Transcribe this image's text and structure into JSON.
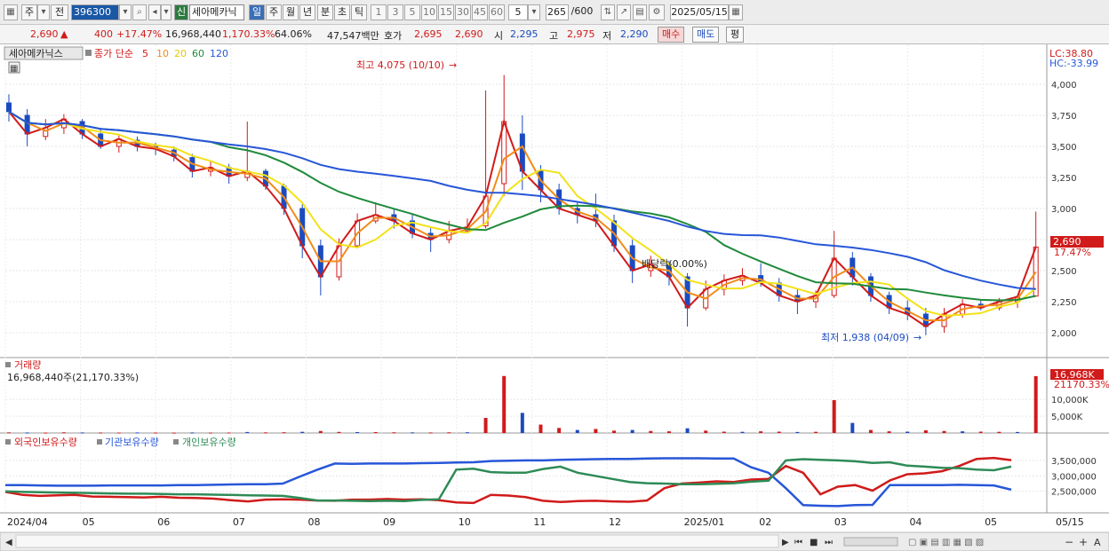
{
  "toolbar": {
    "type_label": "주",
    "prev_label": "전",
    "code": "396300",
    "stock_name": "세아메카닉",
    "new_badge": "신",
    "periods": [
      "일",
      "주",
      "월",
      "년",
      "분",
      "초",
      "틱"
    ],
    "active_period": "일",
    "intervals": [
      "1",
      "3",
      "5",
      "10",
      "15",
      "30",
      "45",
      "60"
    ],
    "interval_value": "5",
    "count_value": "265",
    "count_total": "/600",
    "date": "2025/05/15"
  },
  "quote": {
    "price": "2,690",
    "change": "400",
    "change_pct": "+17.47%",
    "volume": "16,968,440",
    "vol_ratio": "1,170.33%",
    "turnover": "64.06%",
    "amount": "47,547백만",
    "ask_label": "호가",
    "ask1": "2,695",
    "ask2": "2,690",
    "open_label": "시",
    "open": "2,295",
    "high_label": "고",
    "high": "2,975",
    "low_label": "저",
    "low": "2,290",
    "buy": "매수",
    "sell": "매도",
    "eval": "평"
  },
  "colors": {
    "up": "#d11a1a",
    "down": "#1b4bbf",
    "ma5": "#d11a1a",
    "ma10": "#f08c1a",
    "ma20": "#f2e21a",
    "ma60": "#1f8a3b",
    "ma120": "#2756d8",
    "foreign": "#d11a1a",
    "inst": "#2756d8",
    "retail": "#2e8b57"
  },
  "chart_data": [
    {
      "type": "candlestick",
      "panel": "price",
      "name_label": "세아메카닉스",
      "legend_label": "종가 단순",
      "ma_labels": [
        "5",
        "10",
        "20",
        "60",
        "120"
      ],
      "ylim": [
        1800,
        4150
      ],
      "yticks": [
        "4,000",
        "3,750",
        "3,500",
        "3,250",
        "3,000",
        "2,750",
        "2,500",
        "2,250",
        "2,000"
      ],
      "ytick_values": [
        4000,
        3750,
        3500,
        3250,
        3000,
        2750,
        2500,
        2250,
        2000
      ],
      "lc_label": "LC:38.80",
      "hc_label": "HC:-33.99",
      "current_price_label": "2,690",
      "current_pct_label": "17.47%",
      "annotations": {
        "high": "최고 4,075 (10/10)",
        "low": "최저 1,938 (04/09)",
        "dividend": "배당락(0.00%)"
      },
      "candles": [
        [
          3850,
          3780,
          3920,
          3700
        ],
        [
          3750,
          3600,
          3800,
          3500
        ],
        [
          3580,
          3650,
          3720,
          3550
        ],
        [
          3650,
          3720,
          3760,
          3600
        ],
        [
          3700,
          3600,
          3720,
          3560
        ],
        [
          3600,
          3500,
          3650,
          3480
        ],
        [
          3500,
          3560,
          3600,
          3450
        ],
        [
          3550,
          3500,
          3580,
          3460
        ],
        [
          3500,
          3480,
          3530,
          3430
        ],
        [
          3470,
          3420,
          3500,
          3380
        ],
        [
          3410,
          3300,
          3440,
          3250
        ],
        [
          3300,
          3330,
          3380,
          3260
        ],
        [
          3330,
          3260,
          3360,
          3200
        ],
        [
          3250,
          3300,
          3700,
          3220
        ],
        [
          3300,
          3180,
          3320,
          3150
        ],
        [
          3180,
          3000,
          3200,
          2950
        ],
        [
          3000,
          2700,
          3050,
          2600
        ],
        [
          2700,
          2450,
          2750,
          2300
        ],
        [
          2450,
          2700,
          2760,
          2420
        ],
        [
          2700,
          2900,
          2960,
          2680
        ],
        [
          2900,
          2950,
          3050,
          2880
        ],
        [
          2950,
          2900,
          3000,
          2840
        ],
        [
          2900,
          2800,
          2950,
          2760
        ],
        [
          2800,
          2750,
          2850,
          2650
        ],
        [
          2750,
          2820,
          2900,
          2720
        ],
        [
          2820,
          2850,
          2920,
          2800
        ],
        [
          2860,
          3100,
          3950,
          2840
        ],
        [
          3200,
          3700,
          4075,
          3100
        ],
        [
          3600,
          3300,
          3750,
          3150
        ],
        [
          3300,
          3150,
          3350,
          3050
        ],
        [
          3150,
          3000,
          3200,
          2950
        ],
        [
          3000,
          2950,
          3050,
          2880
        ],
        [
          2950,
          2900,
          3120,
          2850
        ],
        [
          2900,
          2700,
          2950,
          2650
        ],
        [
          2700,
          2500,
          2750,
          2400
        ],
        [
          2500,
          2550,
          2620,
          2450
        ],
        [
          2550,
          2450,
          2580,
          2380
        ],
        [
          2450,
          2200,
          2480,
          2050
        ],
        [
          2200,
          2350,
          2420,
          2180
        ],
        [
          2350,
          2420,
          2470,
          2300
        ],
        [
          2420,
          2460,
          2520,
          2380
        ],
        [
          2460,
          2400,
          2560,
          2370
        ],
        [
          2400,
          2300,
          2440,
          2250
        ],
        [
          2300,
          2250,
          2350,
          2150
        ],
        [
          2250,
          2300,
          2340,
          2200
        ],
        [
          2300,
          2600,
          2820,
          2280
        ],
        [
          2600,
          2450,
          2650,
          2380
        ],
        [
          2450,
          2300,
          2480,
          2250
        ],
        [
          2300,
          2200,
          2330,
          2150
        ],
        [
          2200,
          2150,
          2260,
          2100
        ],
        [
          2150,
          2050,
          2200,
          1980
        ],
        [
          2050,
          2150,
          2200,
          2000
        ],
        [
          2150,
          2230,
          2270,
          2120
        ],
        [
          2230,
          2200,
          2260,
          2180
        ],
        [
          2200,
          2250,
          2280,
          2180
        ],
        [
          2250,
          2290,
          2300,
          2200
        ],
        [
          2295,
          2690,
          2975,
          2290
        ]
      ]
    },
    {
      "type": "bar",
      "panel": "volume",
      "title": "거래량",
      "value_label": "16,968,440주(21,170.33%)",
      "ylim": [
        0,
        18000
      ],
      "yticks": [
        "10,000K",
        "5,000K"
      ],
      "ytick_values": [
        10000,
        5000
      ],
      "current_label": "16,968K",
      "current_pct": "21170.33%",
      "values": [
        180,
        150,
        120,
        200,
        160,
        140,
        130,
        150,
        120,
        110,
        160,
        120,
        140,
        300,
        180,
        220,
        350,
        600,
        320,
        280,
        260,
        200,
        180,
        160,
        200,
        220,
        4500,
        17000,
        6000,
        2500,
        1500,
        900,
        1200,
        700,
        900,
        600,
        500,
        1400,
        700,
        400,
        350,
        500,
        400,
        300,
        350,
        9800,
        3000,
        900,
        500,
        400,
        800,
        600,
        500,
        400,
        350,
        300,
        16968
      ]
    },
    {
      "type": "line",
      "panel": "holdings",
      "legend": [
        "외국인보유수량",
        "기관보유수량",
        "개인보유수량"
      ],
      "ylim": [
        1800000,
        3900000
      ],
      "yticks": [
        "3,500,000",
        "3,000,000",
        "2,500,000"
      ],
      "ytick_values": [
        3500000,
        3000000,
        2500000
      ],
      "series": [
        {
          "name": "외국인보유수량",
          "values": [
            2480000,
            2380000,
            2350000,
            2370000,
            2380000,
            2330000,
            2320000,
            2310000,
            2300000,
            2320000,
            2290000,
            2280000,
            2260000,
            2210000,
            2170000,
            2230000,
            2240000,
            2230000,
            2200000,
            2190000,
            2230000,
            2230000,
            2250000,
            2230000,
            2240000,
            2210000,
            2140000,
            2120000,
            2380000,
            2360000,
            2310000,
            2190000,
            2150000,
            2180000,
            2190000,
            2170000,
            2160000,
            2200000,
            2600000,
            2750000,
            2780000,
            2820000,
            2800000,
            2880000,
            2900000,
            3320000,
            3100000,
            2400000,
            2650000,
            2700000,
            2520000,
            2850000,
            3050000,
            3080000,
            3150000,
            3320000,
            3550000,
            3580000,
            3510000
          ]
        },
        {
          "name": "기관보유수량",
          "values": [
            2700000,
            2700000,
            2690000,
            2680000,
            2680000,
            2680000,
            2690000,
            2690000,
            2690000,
            2690000,
            2700000,
            2700000,
            2710000,
            2720000,
            2730000,
            2730000,
            2750000,
            2980000,
            3200000,
            3400000,
            3390000,
            3400000,
            3400000,
            3400000,
            3410000,
            3420000,
            3430000,
            3440000,
            3480000,
            3490000,
            3500000,
            3500000,
            3520000,
            3530000,
            3540000,
            3550000,
            3550000,
            3560000,
            3570000,
            3570000,
            3570000,
            3560000,
            3560000,
            3280000,
            3100000,
            2600000,
            2050000,
            2030000,
            2020000,
            2050000,
            2060000,
            2700000,
            2700000,
            2700000,
            2700000,
            2710000,
            2700000,
            2690000,
            2550000
          ]
        },
        {
          "name": "개인보유수량",
          "values": [
            2500000,
            2480000,
            2470000,
            2460000,
            2450000,
            2440000,
            2430000,
            2420000,
            2420000,
            2410000,
            2400000,
            2400000,
            2390000,
            2380000,
            2370000,
            2360000,
            2350000,
            2280000,
            2200000,
            2200000,
            2190000,
            2180000,
            2190000,
            2180000,
            2220000,
            2240000,
            3200000,
            3230000,
            3120000,
            3100000,
            3100000,
            3220000,
            3300000,
            3100000,
            3000000,
            2900000,
            2800000,
            2760000,
            2750000,
            2730000,
            2730000,
            2740000,
            2760000,
            2810000,
            2840000,
            3500000,
            3540000,
            3520000,
            3500000,
            3470000,
            3420000,
            3440000,
            3330000,
            3300000,
            3260000,
            3250000,
            3200000,
            3180000,
            3300000
          ]
        }
      ]
    }
  ],
  "xaxis": {
    "labels": [
      "2024/04",
      "05",
      "06",
      "07",
      "08",
      "09",
      "10",
      "11",
      "12",
      "2025/01",
      "02",
      "03",
      "04",
      "05",
      "05/15"
    ]
  }
}
